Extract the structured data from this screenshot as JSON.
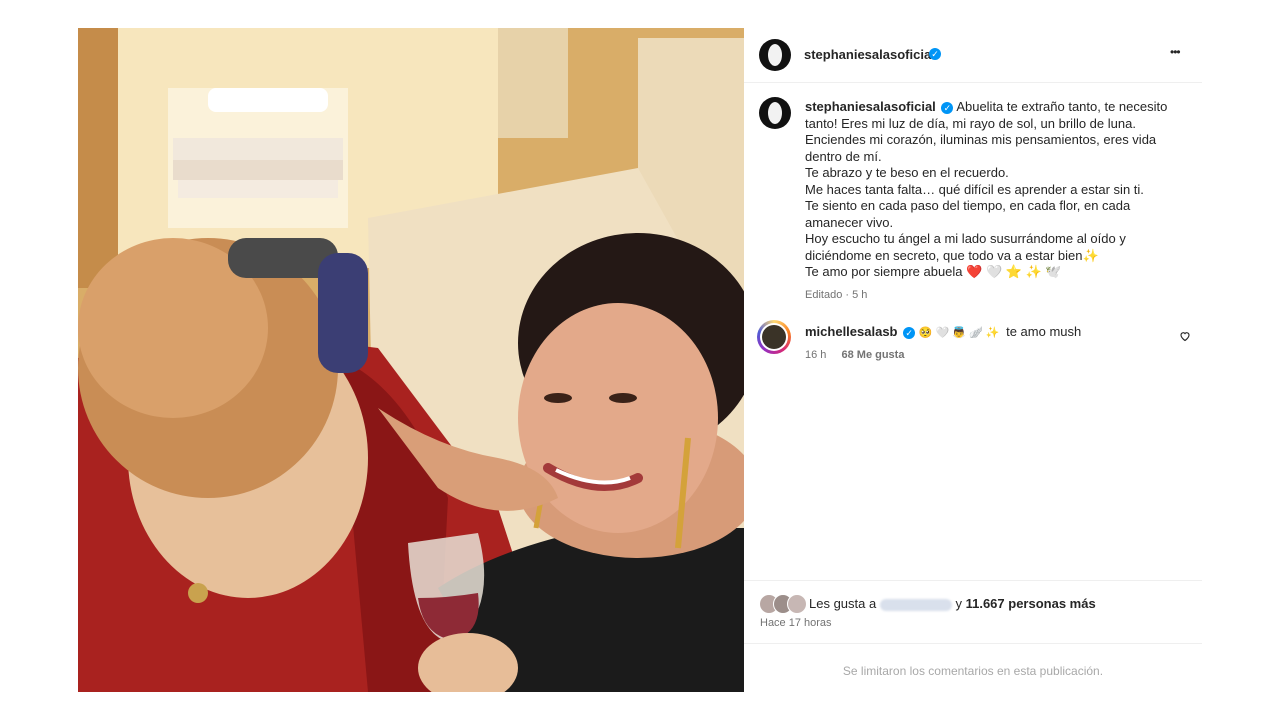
{
  "post": {
    "author": "stephaniesalasoficial",
    "more_label": "•••"
  },
  "caption": {
    "author": "stephaniesalasoficial",
    "lines": [
      "Abuelita te extraño tanto, te necesito",
      "tanto! Eres mi luz de día, mi rayo de sol, un brillo de luna.",
      "Enciendes mi corazón, iluminas mis pensamientos, eres vida",
      "dentro de mí.",
      "Te abrazo y te beso en el recuerdo.",
      "Me haces tanta falta… qué difícil es aprender a estar sin ti.",
      "Te siento en cada paso del tiempo, en cada flor, en cada",
      "amanecer vivo.",
      "Hoy escucho tu ángel a mi lado susurrándome al oído y",
      "diciéndome en secreto, que todo va a estar bien✨",
      "Te amo por siempre abuela ❤️ 🤍 ⭐ ✨ 🕊️"
    ],
    "edited": "Editado · 5 h"
  },
  "comment": {
    "author": "michellesalasb",
    "emojis": "🥺 🤍 👼 🪽 ✨",
    "text": "te amo mush",
    "time": "16 h",
    "likes": "68 Me gusta"
  },
  "likes": {
    "prefix": "Les gusta a",
    "conj": "y",
    "count": "11.667 personas más",
    "time": "Hace 17 horas"
  },
  "footer": {
    "notice": "Se limitaron los comentarios en esta publicación."
  },
  "colors": {
    "accent": "#0095f6",
    "heart": "#e02424"
  }
}
